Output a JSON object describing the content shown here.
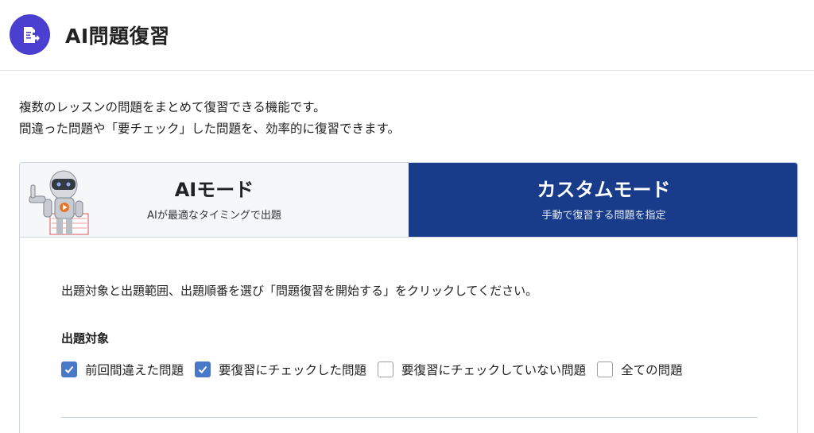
{
  "header": {
    "title": "AI問題復習",
    "icon": "document-arrow-icon",
    "icon_color": "#4b3fd0"
  },
  "intro": {
    "line1": "複数のレッスンの問題をまとめて復習できる機能です。",
    "line2": "間違った問題や「要チェック」した問題を、効率的に復習できます。"
  },
  "tabs": [
    {
      "title": "AIモード",
      "subtitle": "AIが最適なタイミングで出題",
      "active": false
    },
    {
      "title": "カスタムモード",
      "subtitle": "手動で復習する問題を指定",
      "active": true
    }
  ],
  "custom": {
    "instruction": "出題対象と出題範囲、出題順番を選び「問題復習を開始する」をクリックしてください。",
    "target_label": "出題対象",
    "options": [
      {
        "label": "前回間違えた問題",
        "checked": true
      },
      {
        "label": "要復習にチェックした問題",
        "checked": true
      },
      {
        "label": "要復習にチェックしていない問題",
        "checked": false
      },
      {
        "label": "全ての問題",
        "checked": false
      }
    ]
  },
  "colors": {
    "accent": "#193c8a",
    "checkbox": "#4a78c9"
  }
}
